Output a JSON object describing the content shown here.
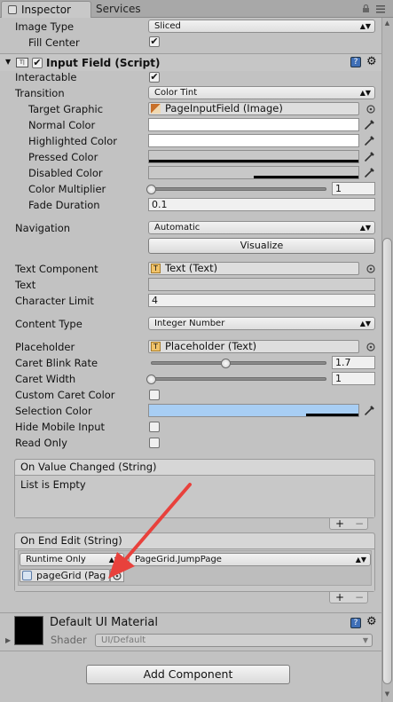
{
  "tabs": {
    "inspector": "Inspector",
    "services": "Services"
  },
  "image_section": {
    "image_type_label": "Image Type",
    "image_type_value": "Sliced",
    "fill_center_label": "Fill Center",
    "fill_center_checked": "✔"
  },
  "component": {
    "title": "Input Field (Script)",
    "enabled_checked": "✔"
  },
  "rows": {
    "interactable": "Interactable",
    "interactable_checked": "✔",
    "transition": "Transition",
    "transition_value": "Color Tint",
    "target_graphic": "Target Graphic",
    "target_graphic_value": "PageInputField (Image)",
    "normal_color": "Normal Color",
    "highlighted_color": "Highlighted Color",
    "pressed_color": "Pressed Color",
    "disabled_color": "Disabled Color",
    "color_multiplier": "Color Multiplier",
    "color_multiplier_value": "1",
    "fade_duration": "Fade Duration",
    "fade_duration_value": "0.1",
    "navigation": "Navigation",
    "navigation_value": "Automatic",
    "visualize": "Visualize",
    "text_component": "Text Component",
    "text_component_value": "Text (Text)",
    "text": "Text",
    "text_value": "",
    "character_limit": "Character Limit",
    "character_limit_value": "4",
    "content_type": "Content Type",
    "content_type_value": "Integer Number",
    "placeholder": "Placeholder",
    "placeholder_value": "Placeholder (Text)",
    "caret_blink_rate": "Caret Blink Rate",
    "caret_blink_rate_value": "1.7",
    "caret_width": "Caret Width",
    "caret_width_value": "1",
    "custom_caret_color": "Custom Caret Color",
    "selection_color": "Selection Color",
    "hide_mobile_input": "Hide Mobile Input",
    "read_only": "Read Only"
  },
  "colors": {
    "normal": "#ffffff",
    "highlighted": "#ffffff",
    "pressed": "#c8c8c8",
    "disabled": "#c8c8c8",
    "selection": "#a8cef4"
  },
  "sliders": {
    "color_multiplier": 0,
    "caret_blink_rate": 0.425,
    "caret_width": 0
  },
  "on_value_changed": {
    "title": "On Value Changed (String)",
    "empty_text": "List is Empty",
    "plus": "+",
    "minus": "−"
  },
  "on_end_edit": {
    "title": "On End Edit (String)",
    "runtime": "Runtime Only",
    "function": "PageGrid.JumpPage",
    "object": "pageGrid (Pag",
    "plus": "+",
    "minus": "−"
  },
  "material": {
    "name": "Default UI Material",
    "shader_label": "Shader",
    "shader_value": "UI/Default"
  },
  "add_component": "Add Component",
  "annotation_color": "#e8413c"
}
